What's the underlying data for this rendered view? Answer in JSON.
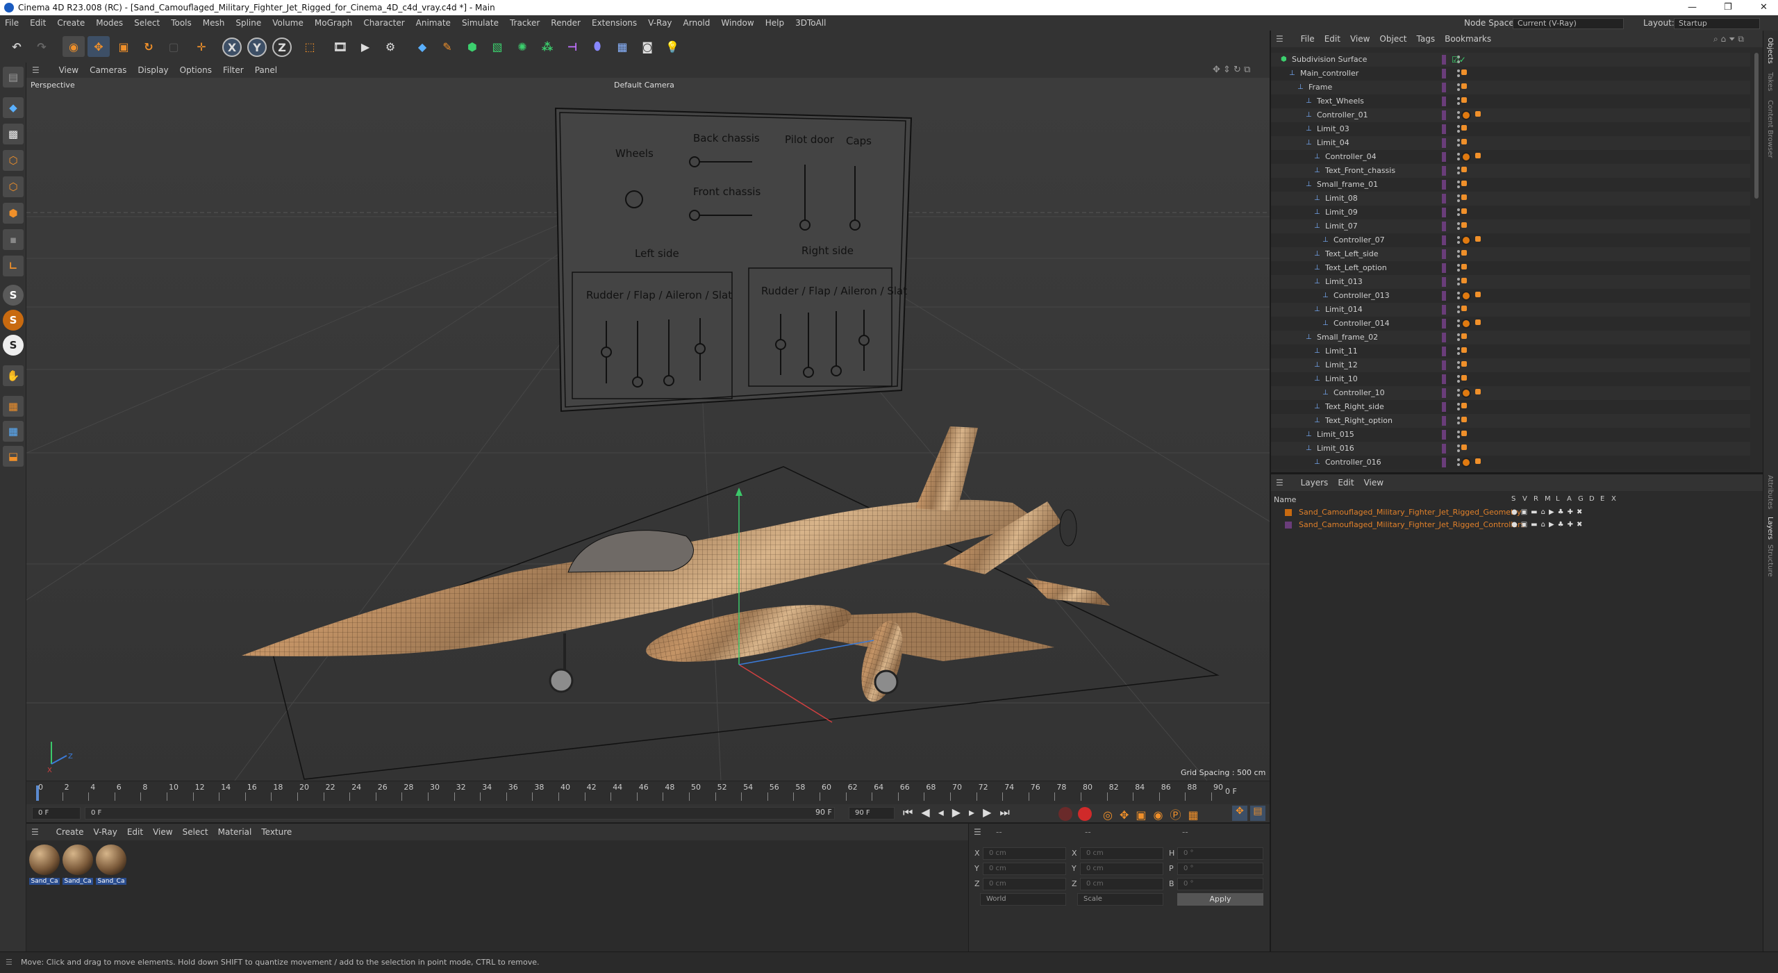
{
  "window": {
    "title": "Cinema 4D R23.008 (RC) - [Sand_Camouflaged_Military_Fighter_Jet_Rigged_for_Cinema_4D_c4d_vray.c4d *] - Main",
    "minimize": "—",
    "maximize": "❐",
    "close": "✕"
  },
  "menu": {
    "items": [
      "File",
      "Edit",
      "Create",
      "Modes",
      "Select",
      "Tools",
      "Mesh",
      "Spline",
      "Volume",
      "MoGraph",
      "Character",
      "Animate",
      "Simulate",
      "Tracker",
      "Render",
      "Extensions",
      "V-Ray",
      "Arnold",
      "Window",
      "Help",
      "3DToAll"
    ],
    "node_space_label": "Node Space:",
    "node_space_value": "Current (V-Ray)",
    "layout_label": "Layout:",
    "layout_value": "Startup"
  },
  "toolbar": {
    "axis_x": "X",
    "axis_y": "Y",
    "axis_z": "Z"
  },
  "viewport": {
    "menu": [
      "View",
      "Cameras",
      "Display",
      "Options",
      "Filter",
      "Panel"
    ],
    "projection": "Perspective",
    "camera": "Default Camera",
    "grid_spacing": "Grid Spacing : 500 cm",
    "board": {
      "wheels": "Wheels",
      "back_chassis": "Back chassis",
      "front_chassis": "Front chassis",
      "pilot_door": "Pilot door",
      "caps": "Caps",
      "left_side": "Left side",
      "right_side": "Right side",
      "rudder_left": "Rudder / Flap / Aileron / Slat",
      "rudder_right": "Rudder / Flap / Aileron / Slat"
    }
  },
  "timeline": {
    "ticks": [
      "0",
      "2",
      "4",
      "6",
      "8",
      "10",
      "12",
      "14",
      "16",
      "18",
      "20",
      "22",
      "24",
      "26",
      "28",
      "30",
      "32",
      "34",
      "36",
      "38",
      "40",
      "42",
      "44",
      "46",
      "48",
      "50",
      "52",
      "54",
      "56",
      "58",
      "60",
      "62",
      "64",
      "66",
      "68",
      "70",
      "72",
      "74",
      "76",
      "78",
      "80",
      "82",
      "84",
      "86",
      "88",
      "90"
    ],
    "frame_display": "0 F",
    "current_frame": "0 F",
    "start_frame": "0 F",
    "end_frame_a": "90 F",
    "end_frame_b": "90 F"
  },
  "materials": {
    "menu": [
      "Create",
      "V-Ray",
      "Edit",
      "View",
      "Select",
      "Material",
      "Texture"
    ],
    "items": [
      "Sand_Ca",
      "Sand_Ca",
      "Sand_Ca"
    ]
  },
  "coordinates": {
    "header": "--",
    "header2": "--",
    "header3": "--",
    "rows": [
      {
        "a": "X",
        "av": "0 cm",
        "b": "X",
        "bv": "0 cm",
        "c": "H",
        "cv": "0 °"
      },
      {
        "a": "Y",
        "av": "0 cm",
        "b": "Y",
        "bv": "0 cm",
        "c": "P",
        "cv": "0 °"
      },
      {
        "a": "Z",
        "av": "0 cm",
        "b": "Z",
        "bv": "0 cm",
        "c": "B",
        "cv": "0 °"
      }
    ],
    "world": "World",
    "scale": "Scale",
    "apply": "Apply"
  },
  "objects": {
    "menu": [
      "File",
      "Edit",
      "View",
      "Object",
      "Tags",
      "Bookmarks"
    ],
    "rows": [
      {
        "name": "Subdivision Surface",
        "level": 0
      },
      {
        "name": "Main_controller",
        "level": 1
      },
      {
        "name": "Frame",
        "level": 2
      },
      {
        "name": "Text_Wheels",
        "level": 3
      },
      {
        "name": "Controller_01",
        "level": 3
      },
      {
        "name": "Limit_03",
        "level": 3
      },
      {
        "name": "Limit_04",
        "level": 3
      },
      {
        "name": "Controller_04",
        "level": 4
      },
      {
        "name": "Text_Front_chassis",
        "level": 4
      },
      {
        "name": "Small_frame_01",
        "level": 3
      },
      {
        "name": "Limit_08",
        "level": 4
      },
      {
        "name": "Limit_09",
        "level": 4
      },
      {
        "name": "Limit_07",
        "level": 4
      },
      {
        "name": "Controller_07",
        "level": 5
      },
      {
        "name": "Text_Left_side",
        "level": 4
      },
      {
        "name": "Text_Left_option",
        "level": 4
      },
      {
        "name": "Limit_013",
        "level": 4
      },
      {
        "name": "Controller_013",
        "level": 5
      },
      {
        "name": "Limit_014",
        "level": 4
      },
      {
        "name": "Controller_014",
        "level": 5
      },
      {
        "name": "Small_frame_02",
        "level": 3
      },
      {
        "name": "Limit_11",
        "level": 4
      },
      {
        "name": "Limit_12",
        "level": 4
      },
      {
        "name": "Limit_10",
        "level": 4
      },
      {
        "name": "Controller_10",
        "level": 5
      },
      {
        "name": "Text_Right_side",
        "level": 4
      },
      {
        "name": "Text_Right_option",
        "level": 4
      },
      {
        "name": "Limit_015",
        "level": 3
      },
      {
        "name": "Limit_016",
        "level": 3
      },
      {
        "name": "Controller_016",
        "level": 4
      }
    ]
  },
  "layers": {
    "menu": [
      "Layers",
      "Edit",
      "View"
    ],
    "col_name": "Name",
    "cols": [
      "S",
      "V",
      "R",
      "M",
      "L",
      "A",
      "G",
      "D",
      "E",
      "X"
    ],
    "rows": [
      "Sand_Camouflaged_Military_Fighter_Jet_Rigged_Geometry",
      "Sand_Camouflaged_Military_Fighter_Jet_Rigged_Controllers"
    ]
  },
  "side_tabs": [
    "Objects",
    "Takes",
    "Content Browser",
    "Attributes",
    "Layers",
    "Structure"
  ],
  "status": "Move: Click and drag to move elements. Hold down SHIFT to quantize movement / add to the selection in point mode, CTRL to remove.",
  "colors": {
    "accent": "#f0902a",
    "selection": "#2a4d8f",
    "background": "#2b2b2b"
  }
}
